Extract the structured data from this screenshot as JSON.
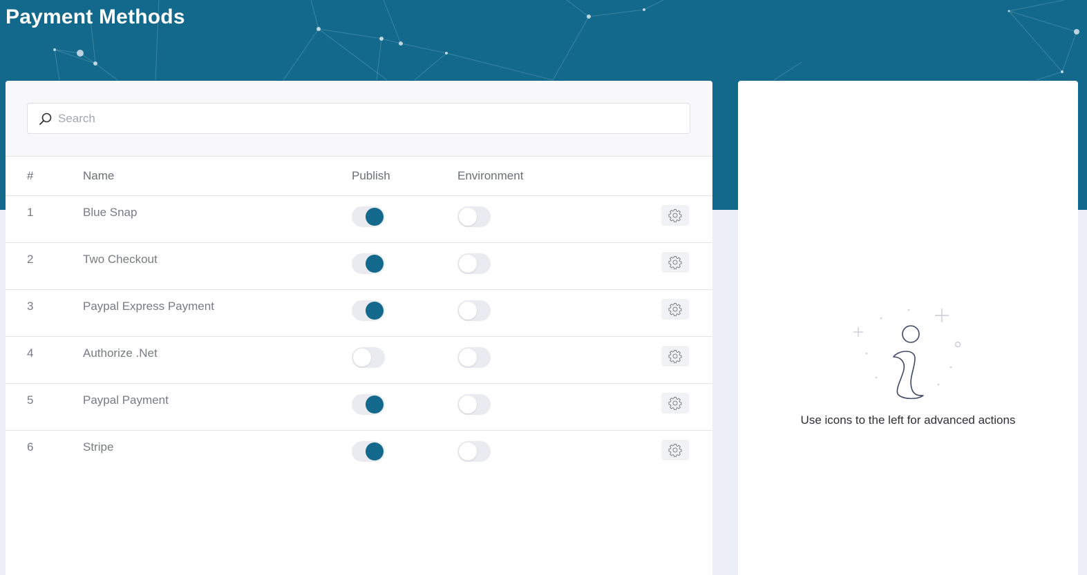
{
  "page": {
    "title": "Payment Methods"
  },
  "search": {
    "placeholder": "Search",
    "value": ""
  },
  "table": {
    "headers": {
      "index": "#",
      "name": "Name",
      "publish": "Publish",
      "environment": "Environment"
    },
    "rows": [
      {
        "index": "1",
        "name": "Blue Snap",
        "publish": true,
        "environment": false
      },
      {
        "index": "2",
        "name": "Two Checkout",
        "publish": true,
        "environment": false
      },
      {
        "index": "3",
        "name": "Paypal Express Payment",
        "publish": true,
        "environment": false
      },
      {
        "index": "4",
        "name": "Authorize .Net",
        "publish": false,
        "environment": false
      },
      {
        "index": "5",
        "name": "Paypal Payment",
        "publish": true,
        "environment": false
      },
      {
        "index": "6",
        "name": "Stripe",
        "publish": true,
        "environment": false
      }
    ]
  },
  "info_panel": {
    "message": "Use icons to the left for advanced actions",
    "icon": "info-icon"
  },
  "colors": {
    "accent": "#12698c",
    "background": "#eceff6",
    "toggle_off": "#e9ebf0"
  }
}
